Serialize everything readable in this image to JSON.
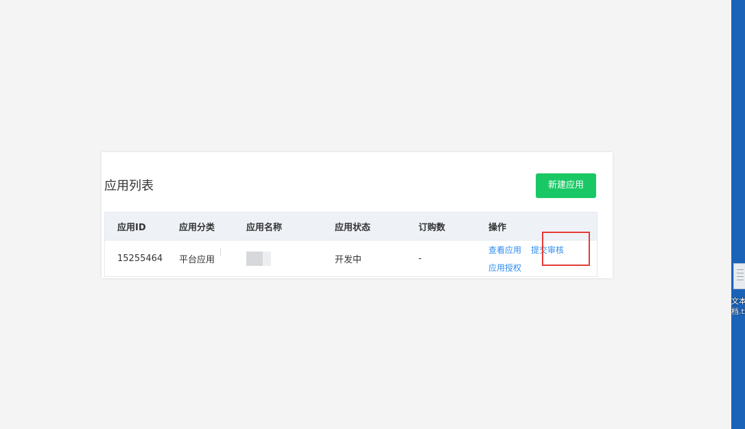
{
  "page": {
    "title": "应用列表",
    "new_app_button": "新建应用"
  },
  "table": {
    "columns": [
      "应用ID",
      "应用分类",
      "应用名称",
      "应用状态",
      "订购数",
      "操作"
    ],
    "rows": [
      {
        "app_id": "15255464",
        "category": "平台应用",
        "name": "",
        "status": "开发中",
        "orders": "-",
        "actions": {
          "view": "查看应用",
          "authorize": "应用授权",
          "submit_review": "提交审核"
        }
      }
    ]
  },
  "annotation": {
    "highlight_color": "#e53935",
    "highlighted_action": "提交审核"
  },
  "desktop": {
    "icon_label": "文本\n档.txt",
    "icon_name": "text-file-icon"
  },
  "colors": {
    "accent_green": "#19c864",
    "link_blue": "#2d8cf0"
  }
}
